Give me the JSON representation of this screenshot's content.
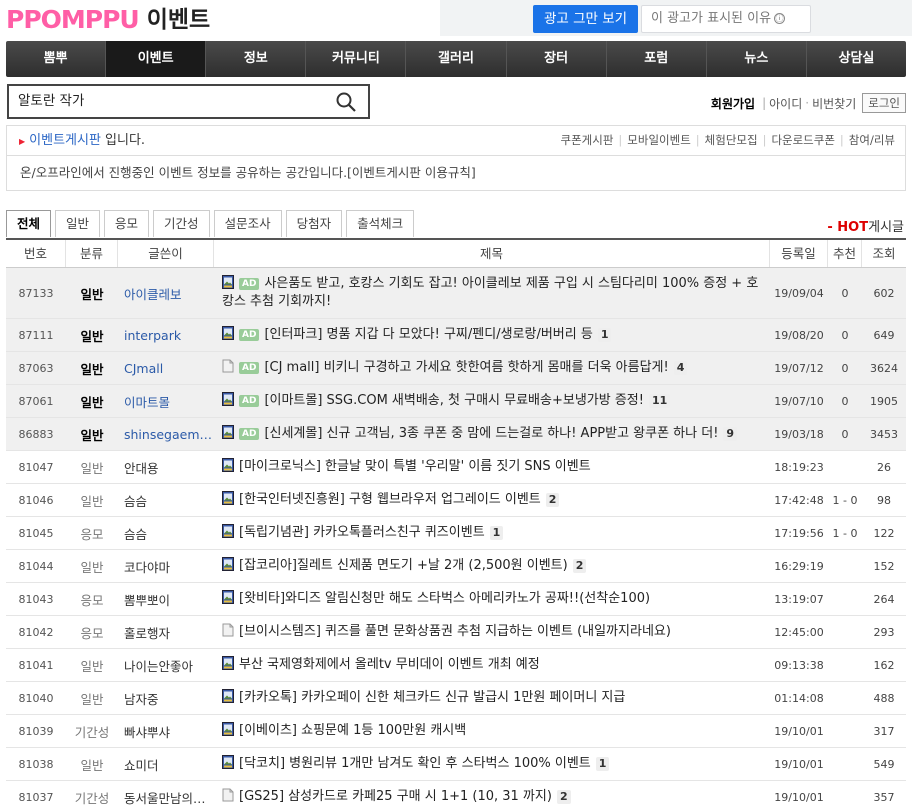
{
  "logo": {
    "text": "PPOMPPU",
    "sub": "이벤트"
  },
  "ad": {
    "stop": "광고 그만 보기",
    "why": "이 광고가 표시된 이유",
    "why_icon": "ⓘ"
  },
  "gnb": [
    "뽐뿌",
    "이벤트",
    "정보",
    "커뮤니티",
    "갤러리",
    "장터",
    "포럼",
    "뉴스",
    "상담실"
  ],
  "search": {
    "query": "알토란 작가"
  },
  "member": {
    "join": "회원가입",
    "id": "아이디",
    "pw": "비번찾기",
    "login": "로그인"
  },
  "board": {
    "name": "이벤트게시판",
    "suffix": " 입니다.",
    "links": [
      "쿠폰게시판",
      "모바일이벤트",
      "체험단모집",
      "다운로드쿠폰",
      "참여/리뷰"
    ],
    "desc": "온/오프라인에서 진행중인 이벤트 정보를 공유하는 공간입니다.[이벤트게시판 이용규칙]"
  },
  "tabs": [
    "전체",
    "일반",
    "응모",
    "기간성",
    "설문조사",
    "당첨자",
    "출석체크"
  ],
  "hot": {
    "dash": "- ",
    "hot": "HOT",
    "rest": "게시글"
  },
  "table": {
    "headers": [
      "번호",
      "분류",
      "글쓴이",
      "제목",
      "등록일",
      "추천",
      "조회"
    ],
    "ad_label": "AD",
    "rows": [
      {
        "no": "87133",
        "cat": "일반",
        "author": "아이클레보",
        "title": "사은품도 받고, 호캉스 기회도 잡고! 아이클레보 제품 구입 시 스팀다리미 100% 증정 + 호캉스 추첨 기회까지!",
        "cmt": "",
        "date": "19/09/04",
        "rec": "0",
        "views": "602",
        "notice": true,
        "ad": true,
        "icon": "image"
      },
      {
        "no": "87111",
        "cat": "일반",
        "author": "interpark",
        "title": "[인터파크] 명품 지갑 다 모았다! 구찌/펜디/생로랑/버버리 등",
        "cmt": "1",
        "date": "19/08/20",
        "rec": "0",
        "views": "649",
        "notice": true,
        "ad": true,
        "icon": "image"
      },
      {
        "no": "87063",
        "cat": "일반",
        "author": "CJmall",
        "title": "[CJ mall] 비키니 구경하고 가세요 핫한여름 핫하게 몸매를 더욱 아름답게!",
        "cmt": "4",
        "date": "19/07/12",
        "rec": "0",
        "views": "3624",
        "notice": true,
        "ad": true,
        "icon": "doc"
      },
      {
        "no": "87061",
        "cat": "일반",
        "author": "이마트몰",
        "title": "[이마트몰] SSG.COM 새벽배송, 첫 구매시 무료배송+보냉가방 증정!",
        "cmt": "11",
        "date": "19/07/10",
        "rec": "0",
        "views": "1905",
        "notice": true,
        "ad": true,
        "icon": "image"
      },
      {
        "no": "86883",
        "cat": "일반",
        "author": "shinsegaemall",
        "title": "[신세계몰] 신규 고객님, 3종 쿠폰 중 맘에 드는걸로 하나! APP받고 왕쿠폰 하나 더!",
        "cmt": "9",
        "date": "19/03/18",
        "rec": "0",
        "views": "3453",
        "notice": true,
        "ad": true,
        "icon": "image"
      },
      {
        "no": "81047",
        "cat": "일반",
        "author": "안대용",
        "title": "[마이크로닉스] 한글날 맞이 특별 '우리말' 이름 짓기 SNS 이벤트",
        "cmt": "",
        "date": "18:19:23",
        "rec": "",
        "views": "26",
        "notice": false,
        "ad": false,
        "icon": "image"
      },
      {
        "no": "81046",
        "cat": "일반",
        "author": "슴슴",
        "title": "[한국인터넷진흥원] 구형 웹브라우저 업그레이드 이벤트",
        "cmt": "2",
        "date": "17:42:48",
        "rec": "1 - 0",
        "views": "98",
        "notice": false,
        "ad": false,
        "icon": "image"
      },
      {
        "no": "81045",
        "cat": "응모",
        "author": "슴슴",
        "title": "[독립기념관] 카카오톡플러스친구 퀴즈이벤트",
        "cmt": "1",
        "date": "17:19:56",
        "rec": "1 - 0",
        "views": "122",
        "notice": false,
        "ad": false,
        "icon": "image"
      },
      {
        "no": "81044",
        "cat": "일반",
        "author": "코다야마",
        "title": "[잡코리아]질레트 신제품 면도기 +날 2개 (2,500원 이벤트)",
        "cmt": "2",
        "date": "16:29:19",
        "rec": "",
        "views": "152",
        "notice": false,
        "ad": false,
        "icon": "image"
      },
      {
        "no": "81043",
        "cat": "응모",
        "author": "뽐뿌뽀이",
        "title": "[왓비타]와디즈 알림신청만 해도 스타벅스 아메리카노가 공짜!!(선착순100)",
        "cmt": "",
        "date": "13:19:07",
        "rec": "",
        "views": "264",
        "notice": false,
        "ad": false,
        "icon": "image"
      },
      {
        "no": "81042",
        "cat": "응모",
        "author": "홀로행자",
        "title": "[브이시스템즈] 퀴즈를 풀면 문화상품권 추첨 지급하는 이벤트 (내일까지라네요)",
        "cmt": "",
        "date": "12:45:00",
        "rec": "",
        "views": "293",
        "notice": false,
        "ad": false,
        "icon": "doc"
      },
      {
        "no": "81041",
        "cat": "일반",
        "author": "나이는안좋아",
        "title": "부산 국제영화제에서 올레tv 무비데이 이벤트 개최 예정",
        "cmt": "",
        "date": "09:13:38",
        "rec": "",
        "views": "162",
        "notice": false,
        "ad": false,
        "icon": "image"
      },
      {
        "no": "81040",
        "cat": "일반",
        "author": "남자중",
        "title": "[카카오톡] 카카오페이 신한 체크카드 신규 발급시 1만원 페이머니 지급",
        "cmt": "",
        "date": "01:14:08",
        "rec": "",
        "views": "488",
        "notice": false,
        "ad": false,
        "icon": "image2"
      },
      {
        "no": "81039",
        "cat": "기간성",
        "author": "빠샤뿌샤",
        "title": "[이베이츠] 쇼핑문예 1등 100만원 캐시백",
        "cmt": "",
        "date": "19/10/01",
        "rec": "",
        "views": "317",
        "notice": false,
        "ad": false,
        "icon": "image"
      },
      {
        "no": "81038",
        "cat": "일반",
        "author": "쇼미더",
        "title": "[닥코치] 병원리뷰 1개만 남겨도 확인 후 스타벅스 100% 이벤트",
        "cmt": "1",
        "date": "19/10/01",
        "rec": "",
        "views": "549",
        "notice": false,
        "ad": false,
        "icon": "image"
      },
      {
        "no": "81037",
        "cat": "기간성",
        "author": "동서울만남의광장",
        "title": "[GS25] 삼성카드로 카페25 구매 시 1+1 (10, 31 까지)",
        "cmt": "2",
        "date": "19/10/01",
        "rec": "",
        "views": "357",
        "notice": false,
        "ad": false,
        "icon": "doc"
      }
    ]
  }
}
